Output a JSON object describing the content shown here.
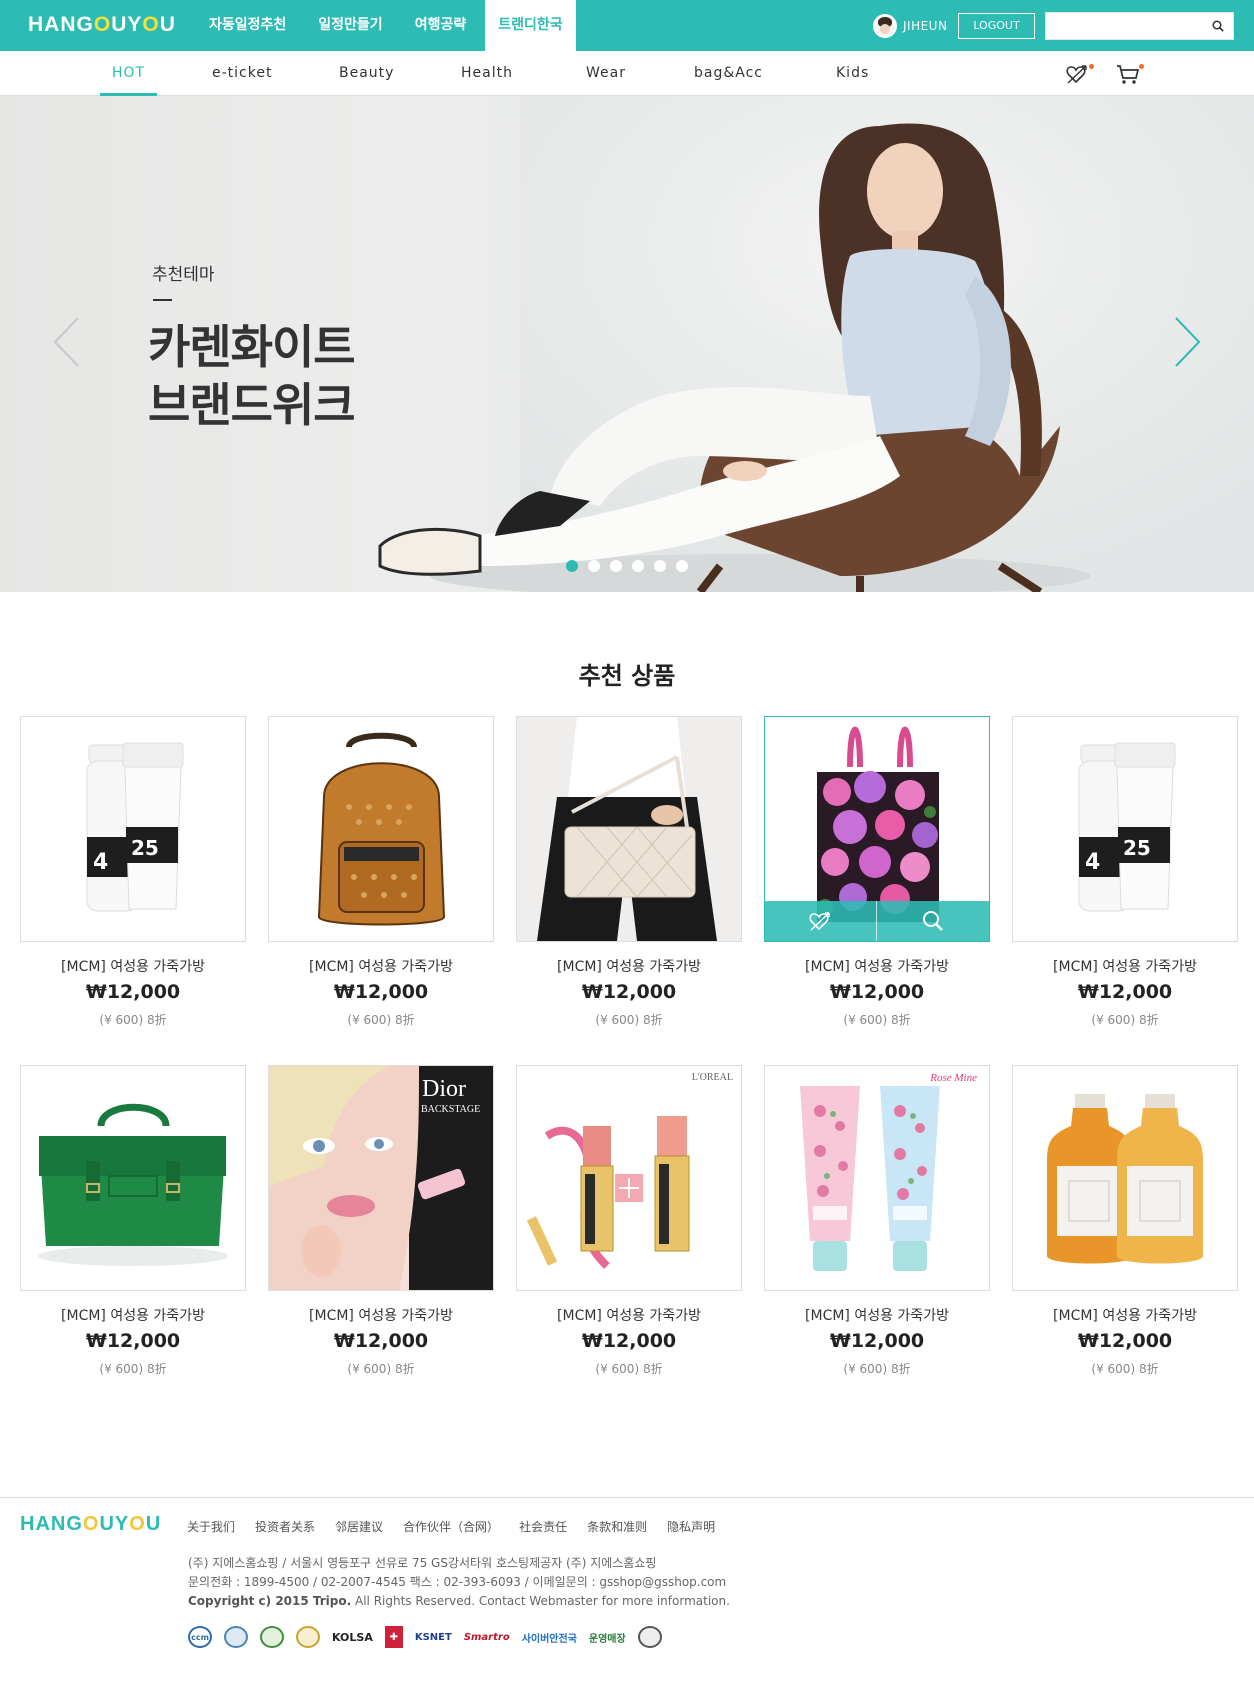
{
  "brand": {
    "logo": "HANGOUYOU"
  },
  "main_nav": [
    "자동일정추천",
    "일정만들기",
    "여행공략",
    "트랜디한국"
  ],
  "main_nav_active": "트랜디한국",
  "user": {
    "name": "JIHEUN",
    "logout_label": "LOGOUT"
  },
  "search": {
    "placeholder": "",
    "value": "",
    "icon": "search-icon"
  },
  "categories": [
    "HOT",
    "e-ticket",
    "Beauty",
    "Health",
    "Wear",
    "bag&Acc",
    "Kids"
  ],
  "category_active": "HOT",
  "category_icons": [
    "wishlist-heart-icon",
    "cart-icon"
  ],
  "hero": {
    "label": "추천테마",
    "title_line1": "카렌화이트",
    "title_line2": "브랜드위크",
    "slide_count": 6,
    "active_slide": 1
  },
  "recommend": {
    "title": "추천 상품",
    "products": [
      {
        "name": "[MCM] 여성용 가죽가방",
        "price": "₩12,000",
        "sub": "(¥ 600) 8折",
        "image": "shampoo-bottles"
      },
      {
        "name": "[MCM] 여성용 가죽가방",
        "price": "₩12,000",
        "sub": "(¥ 600) 8折",
        "image": "mcm-backpack"
      },
      {
        "name": "[MCM] 여성용 가죽가방",
        "price": "₩12,000",
        "sub": "(¥ 600) 8折",
        "image": "quilted-shoulder-bag"
      },
      {
        "name": "[MCM] 여성용 가죽가방",
        "price": "₩12,000",
        "sub": "(¥ 600) 8折",
        "image": "floral-tote-bag"
      },
      {
        "name": "[MCM] 여성용 가죽가방",
        "price": "₩12,000",
        "sub": "(¥ 600) 8折",
        "image": "shampoo-bottles"
      },
      {
        "name": "[MCM] 여성용 가죽가방",
        "price": "₩12,000",
        "sub": "(¥ 600) 8折",
        "image": "green-satchel"
      },
      {
        "name": "[MCM] 여성용 가죽가방",
        "price": "₩12,000",
        "sub": "(¥ 600) 8折",
        "image": "dior-lip-ad",
        "ad_text": "Dior",
        "ad_sub": "BACKSTAGE"
      },
      {
        "name": "[MCM] 여성용 가죽가방",
        "price": "₩12,000",
        "sub": "(¥ 600) 8折",
        "image": "loreal-lip-gloss",
        "ad_text": "L'OREAL"
      },
      {
        "name": "[MCM] 여성용 가죽가방",
        "price": "₩12,000",
        "sub": "(¥ 600) 8折",
        "image": "rosemine-tubes",
        "ad_text": "Rose Mine"
      },
      {
        "name": "[MCM] 여성용 가죽가방",
        "price": "₩12,000",
        "sub": "(¥ 600) 8折",
        "image": "juice-bottles"
      }
    ],
    "hover_product_index": 3,
    "hover_icons": [
      "wishlist-heart-icon",
      "zoom-icon"
    ]
  },
  "footer": {
    "logo": "HANGOUYOU",
    "links": [
      "关于我们",
      "投资者关系",
      "邻居建议",
      "合作伙伴（合网）",
      "社会责任",
      "条款和准则",
      "隐私声明"
    ],
    "address": "(주) 지에스홈쇼핑 / 서울시 영등포구 선유로 75 GS강서타워 호스팅제공자 (주) 지에스홈쇼핑",
    "contact": "문의전화 : 1899-4500 / 02-2007-4545 팩스 : 02-393-6093 / 이메일문의 : gsshop@gsshop.com",
    "copyright_bold": "Copyright c) 2015 Tripo.",
    "copyright_rest": " All Rights Reserved. Contact Webmaster for more information.",
    "badges": [
      "ccm",
      "",
      "",
      "",
      "KOLSA",
      "",
      "KSNET",
      "Smartro",
      "사이버안전국",
      "운영매장",
      ""
    ]
  },
  "colors": {
    "primary": "#2cbcb4",
    "accent_dot": "#f06a2c",
    "logo_o": "#f3e03a"
  }
}
